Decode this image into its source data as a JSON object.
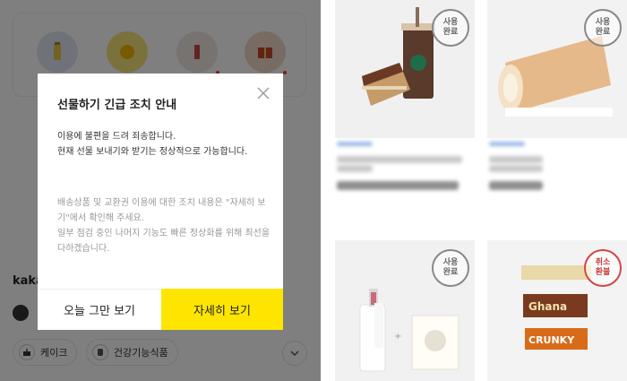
{
  "modal": {
    "title": "선물하기 긴급 조치 안내",
    "line1": "이용에 불편을 드려 죄송합니다.\n현재 선물 보내기와 받기는 정상적으로 가능합니다.",
    "line2": "배송상품 및 교환권 이용에 대한 조치 내용은 \"자세히 보기\"에서 확인해 주세요.\n일부 점검 중인 나머지 기능도 빠른 정상화를 위해 최선을 다하겠습니다.",
    "today_button": "오늘 그만 보기",
    "detail_button": "자세히 보기"
  },
  "left": {
    "kaka_label": "kaka",
    "chips": [
      "케이크",
      "건강기능식품"
    ]
  },
  "right": {
    "stamps": [
      {
        "text": "사용\n완료"
      },
      {
        "text": "사용\n완료"
      },
      {
        "text": "사용\n완료"
      },
      {
        "text": "취소\n환불"
      }
    ]
  },
  "colors": {
    "accent_yellow": "#fee500",
    "overlay": "rgba(0,0,0,0.5)",
    "stamp_gray": "#888888",
    "stamp_red": "#d34545"
  },
  "icons": [
    "close-icon",
    "chevron-down-icon",
    "cake-icon",
    "health-icon"
  ]
}
